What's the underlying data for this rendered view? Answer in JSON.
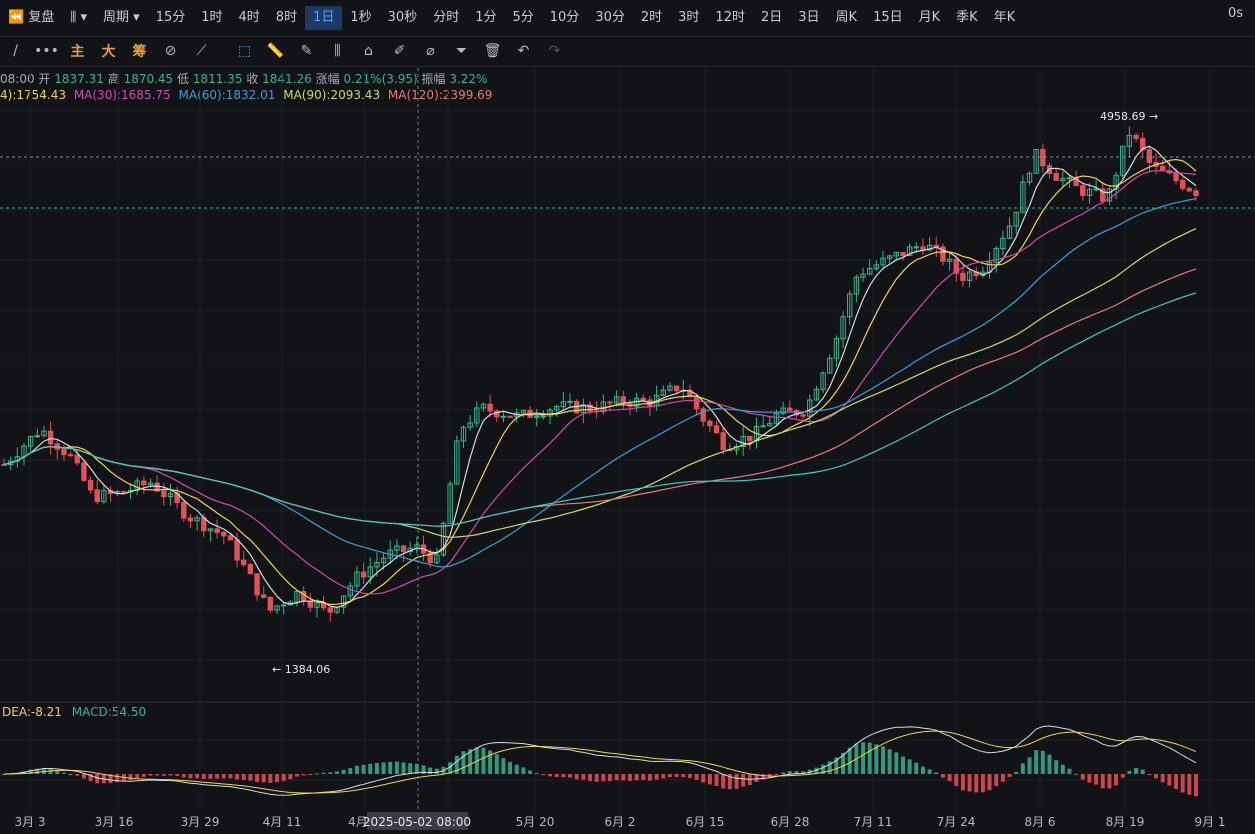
{
  "topbar": {
    "replay": "复盘",
    "period": "周期",
    "intervals": [
      "15分",
      "1时",
      "4时",
      "8时",
      "1日",
      "1秒",
      "30秒",
      "分时",
      "1分",
      "5分",
      "10分",
      "30分",
      "2时",
      "3时",
      "12时",
      "2日",
      "3日",
      "周K",
      "15日",
      "月K",
      "季K",
      "年K"
    ],
    "active_interval": "1日",
    "right_text": "0s"
  },
  "toolbar": {
    "main": "主",
    "big": "大",
    "chip": "筹"
  },
  "ohlc": {
    "time": "08:00",
    "open_label": "开",
    "open": "1837.31",
    "high_label": "高",
    "high": "1870.45",
    "low_label": "低",
    "low": "1811.35",
    "close_label": "收",
    "close": "1841.26",
    "change_label": "涨幅",
    "change": "0.21%(3.95)",
    "amp_label": "振幅",
    "amp": "3.22%"
  },
  "ma_legend": [
    {
      "text": "4):1754.43",
      "color": "#f1d54a"
    },
    {
      "text": "MA(30):1685.75",
      "color": "#d14ab1"
    },
    {
      "text": "MA(60):1832.01",
      "color": "#3aa0d8"
    },
    {
      "text": "MA(90):2093.43",
      "color": "#c7dd6b"
    },
    {
      "text": "MA(120):2399.69",
      "color": "#e8797d"
    }
  ],
  "macd_legend": [
    {
      "text": "DEA:-8.21",
      "color": "#f1d54a"
    },
    {
      "text": "MACD:54.50",
      "color": "#34b58e"
    }
  ],
  "annotations": {
    "high_label": "4958.69 →",
    "low_label": "← 1384.06",
    "crosshair_date": "2025-05-02 08:00"
  },
  "chart_data": {
    "type": "candlestick",
    "x_ticks": [
      "3月 3",
      "3月 16",
      "3月 29",
      "4月 11",
      "4月",
      "5月 20",
      "6月 2",
      "6月 15",
      "6月 28",
      "7月 11",
      "7月 24",
      "8月 6",
      "8月 19",
      "9月 1"
    ],
    "high_marker": 4958.69,
    "low_marker": 1384.06,
    "last_bar": {
      "open": 1837.31,
      "high": 1870.45,
      "low": 1811.35,
      "close": 1841.26,
      "change_pct": 0.21,
      "change": 3.95,
      "amplitude_pct": 3.22
    },
    "moving_averages": [
      {
        "name": "MA(30)",
        "value": 1685.75
      },
      {
        "name": "MA(60)",
        "value": 1832.01
      },
      {
        "name": "MA(90)",
        "value": 2093.43
      },
      {
        "name": "MA(120)",
        "value": 2399.69
      }
    ],
    "macd": {
      "DEA": -8.21,
      "MACD": 54.5
    },
    "colors": {
      "up": "#34b58e",
      "down": "#e0525a",
      "background": "#121316"
    }
  }
}
